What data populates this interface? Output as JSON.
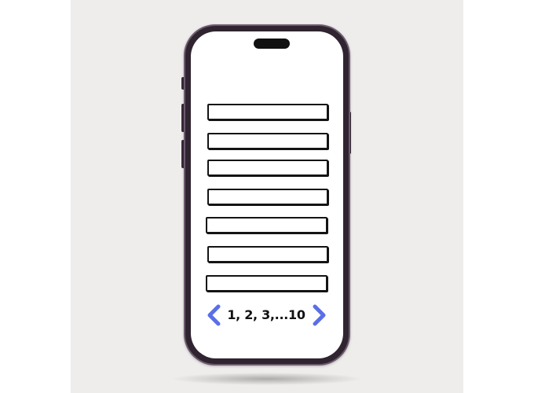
{
  "pagination": {
    "label": "1, 2, 3,...10",
    "prev_icon": "chevron-left-icon",
    "next_icon": "chevron-right-icon"
  },
  "list": {
    "row_count": 7
  },
  "colors": {
    "accent": "#5a6fe6",
    "frame": "#2f2430",
    "background": "#efedec"
  }
}
